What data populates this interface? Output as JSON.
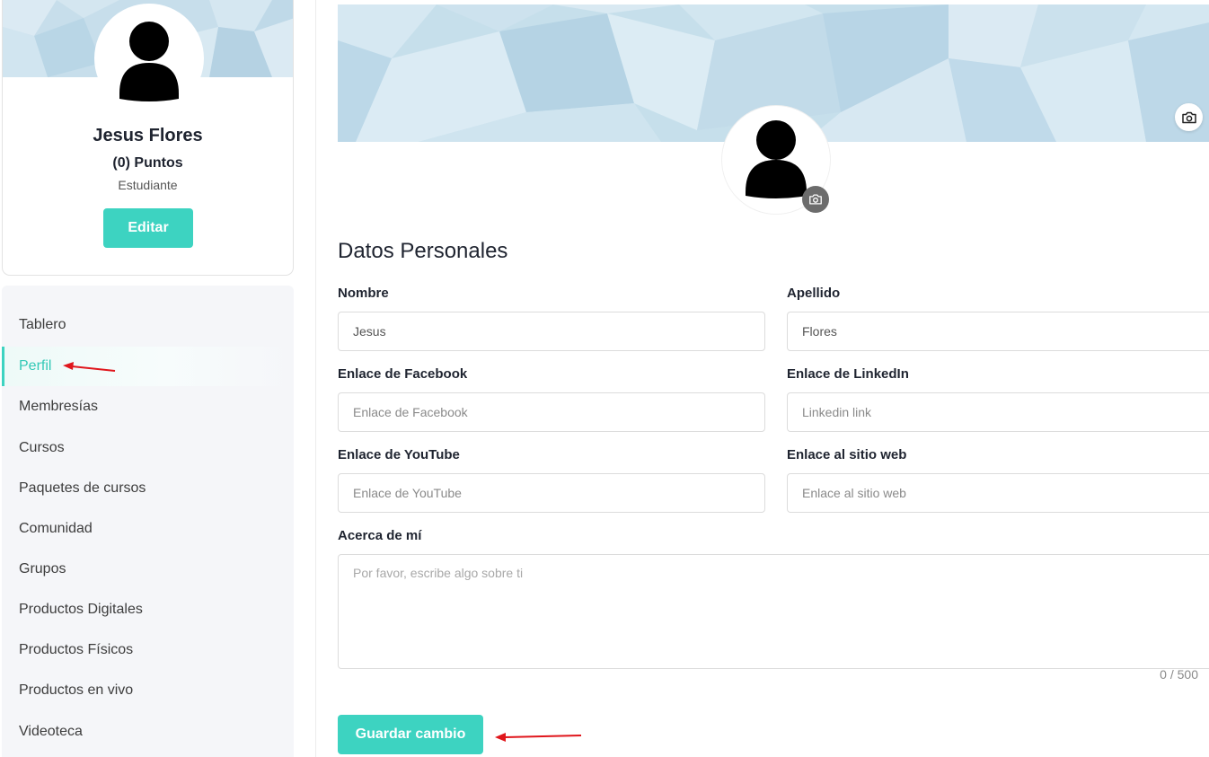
{
  "profile": {
    "name": "Jesus Flores",
    "points": "(0) Puntos",
    "role": "Estudiante",
    "edit_label": "Editar"
  },
  "sidebar": {
    "items": [
      {
        "label": "Tablero",
        "active": false
      },
      {
        "label": "Perfil",
        "active": true
      },
      {
        "label": "Membresías",
        "active": false
      },
      {
        "label": "Cursos",
        "active": false
      },
      {
        "label": "Paquetes de cursos",
        "active": false
      },
      {
        "label": "Comunidad",
        "active": false
      },
      {
        "label": "Grupos",
        "active": false
      },
      {
        "label": "Productos Digitales",
        "active": false
      },
      {
        "label": "Productos Físicos",
        "active": false
      },
      {
        "label": "Productos en vivo",
        "active": false
      },
      {
        "label": "Videoteca",
        "active": false
      }
    ]
  },
  "main": {
    "section_title": "Datos Personales",
    "fields": {
      "first_name": {
        "label": "Nombre",
        "value": "Jesus",
        "placeholder": ""
      },
      "last_name": {
        "label": "Apellido",
        "value": "Flores",
        "placeholder": ""
      },
      "facebook": {
        "label": "Enlace de Facebook",
        "value": "",
        "placeholder": "Enlace de Facebook"
      },
      "linkedin": {
        "label": "Enlace de LinkedIn",
        "value": "",
        "placeholder": "Linkedin link"
      },
      "youtube": {
        "label": "Enlace de YouTube",
        "value": "",
        "placeholder": "Enlace de YouTube"
      },
      "website": {
        "label": "Enlace al sitio web",
        "value": "",
        "placeholder": "Enlace al sitio web"
      },
      "about": {
        "label": "Acerca de mí",
        "value": "",
        "placeholder": "Por favor, escribe algo sobre ti"
      }
    },
    "char_count": "0 / 500",
    "save_label": "Guardar cambio"
  },
  "icons": {
    "cover_camera": "camera-icon",
    "avatar_camera": "camera-icon",
    "avatar": "user-silhouette-icon"
  },
  "colors": {
    "accent": "#3dd3c1",
    "cover_background": "#c6dfeb",
    "sidebar_background": "#f5f6f9",
    "annotation_arrow": "#e0161c"
  }
}
